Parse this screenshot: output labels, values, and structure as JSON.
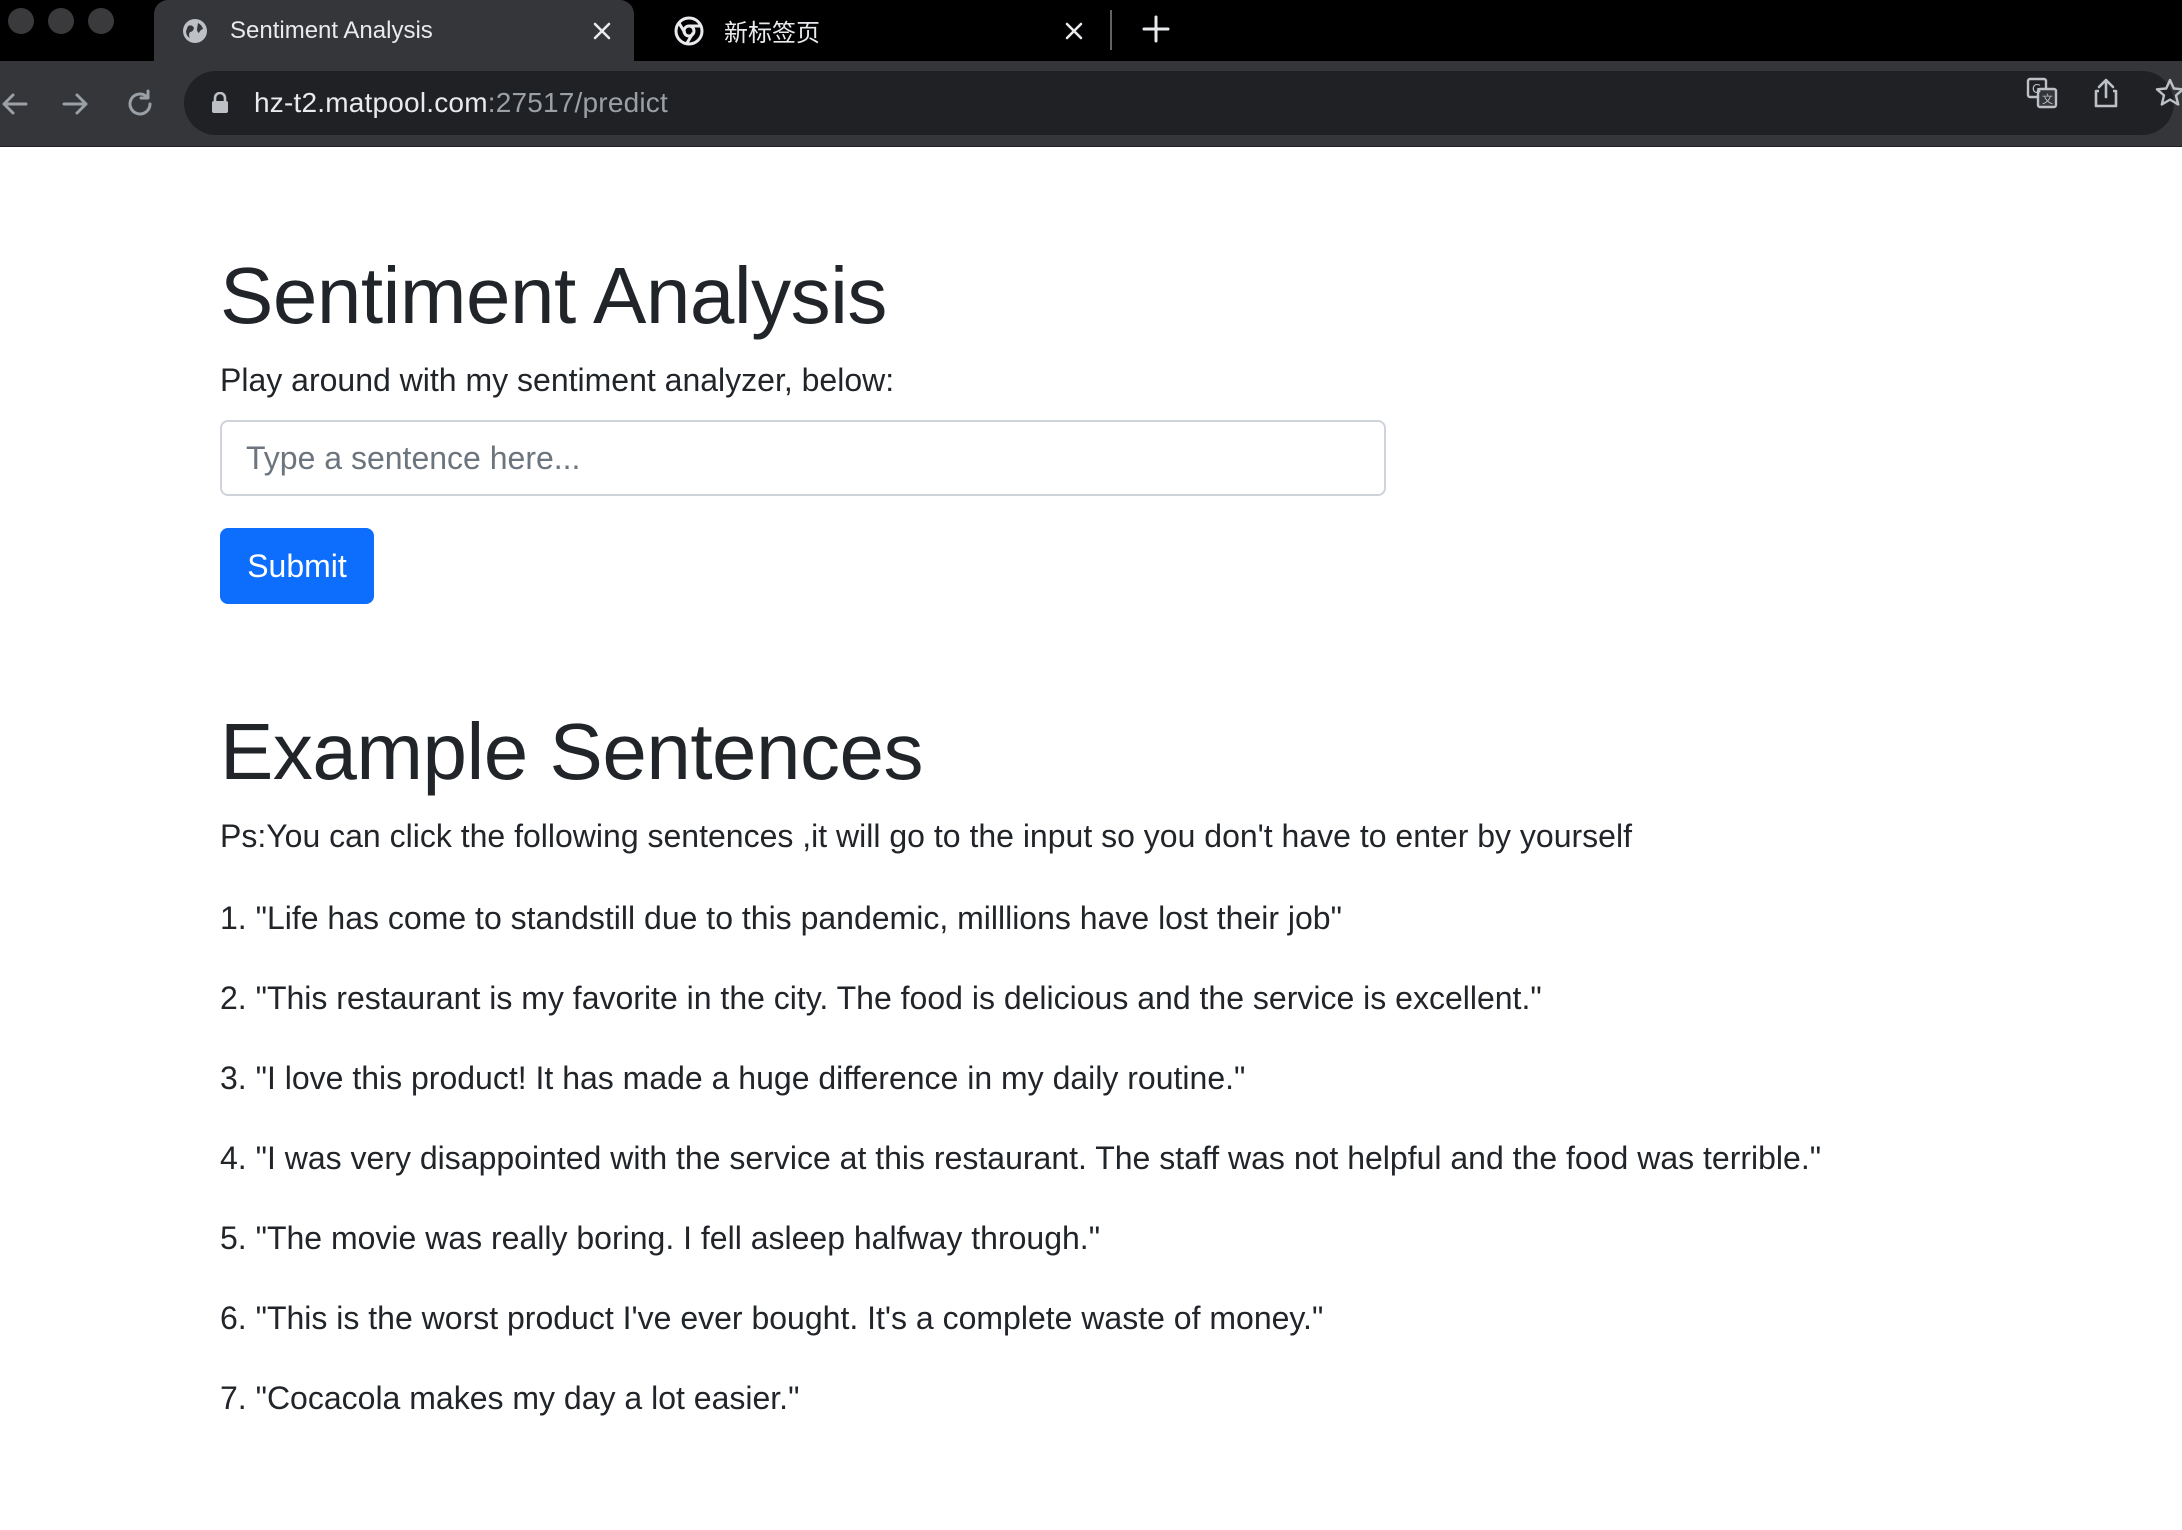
{
  "browser": {
    "tabs": [
      {
        "title": "Sentiment Analysis",
        "active": true,
        "favicon": "globe-icon"
      },
      {
        "title": "新标签页",
        "active": false,
        "favicon": "chrome-icon"
      }
    ],
    "address": {
      "host": "hz-t2.matpool.com",
      "rest": ":27517/predict"
    }
  },
  "page": {
    "title": "Sentiment Analysis",
    "lead": "Play around with my sentiment analyzer, below:",
    "input_placeholder": "Type a sentence here...",
    "input_value": "",
    "submit_label": "Submit",
    "examples_title": "Example Sentences",
    "examples_hint": "Ps:You can click the following sentences ,it will go to the input so you don't have to enter by yourself",
    "examples": [
      "1. \"Life has come to standstill due to this pandemic, milllions have lost their job\"",
      "2. \"This restaurant is my favorite in the city. The food is delicious and the service is excellent.\"",
      "3. \"I love this product! It has made a huge difference in my daily routine.\"",
      "4. \"I was very disappointed with the service at this restaurant. The staff was not helpful and the food was terrible.\"",
      "5. \"The movie was really boring. I fell asleep halfway through.\"",
      "6. \"This is the worst product I've ever bought. It's a complete waste of money.\"",
      "7. \"Cocacola makes my day a lot easier.\""
    ]
  },
  "colors": {
    "primary_button": "#0d6efd",
    "text": "#212529",
    "chrome_dark": "#35363a"
  }
}
